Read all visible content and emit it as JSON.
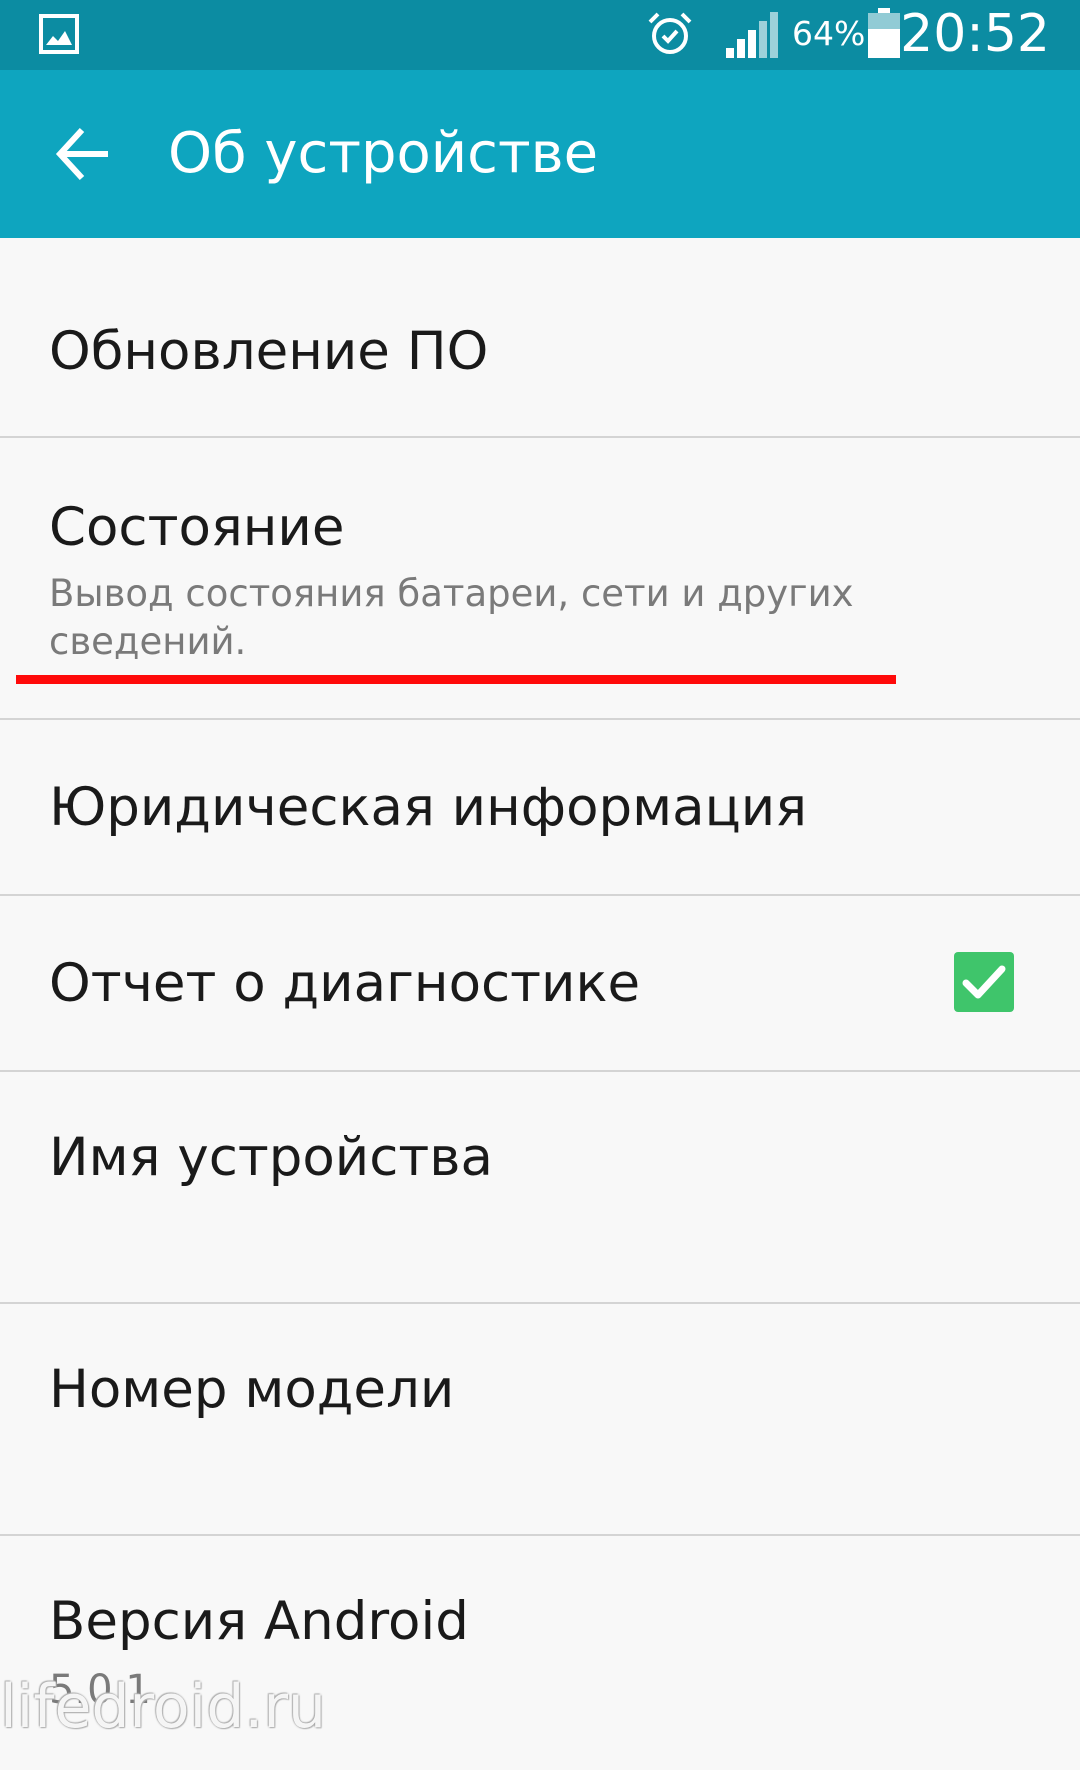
{
  "status_bar": {
    "battery_percent": "64%",
    "time": "20:52",
    "icons": [
      "gallery-icon",
      "alarm-icon",
      "signal-icon",
      "battery-icon"
    ]
  },
  "app_bar": {
    "title": "Об устройстве",
    "back_icon": "arrow-back-icon"
  },
  "items": [
    {
      "label": "Обновление ПО"
    },
    {
      "label": "Состояние",
      "summary": "Вывод состояния батареи, сети и других сведений."
    },
    {
      "label": "Юридическая информация"
    },
    {
      "label": "Отчет о диагностике",
      "checked": true
    },
    {
      "label": "Имя устройства"
    },
    {
      "label": "Номер модели"
    },
    {
      "label": "Версия Android",
      "summary": "5.0.1"
    }
  ],
  "watermark": "lifedroid.ru",
  "colors": {
    "status_bar": "#0c8ca2",
    "app_bar": "#0ea5bf",
    "highlight": "#ff0a0a",
    "checkbox": "#3fc56b"
  }
}
